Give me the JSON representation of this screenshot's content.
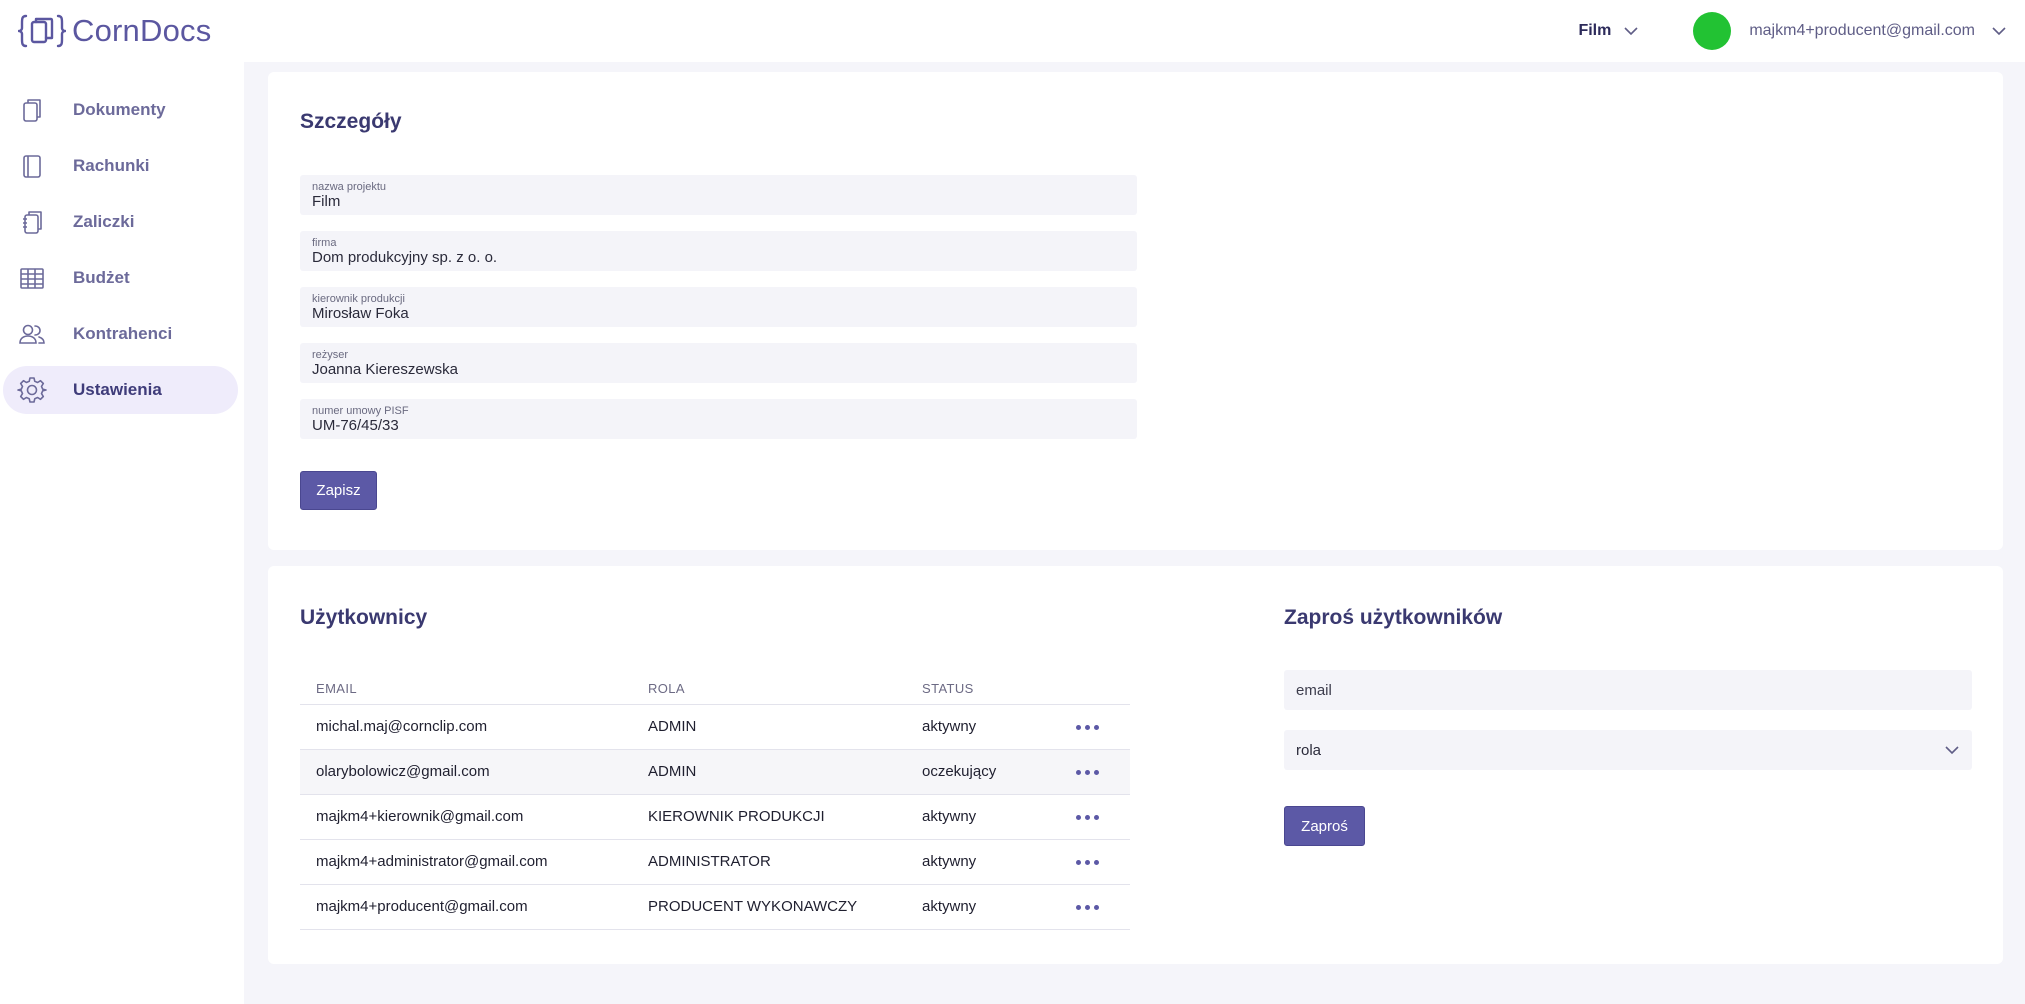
{
  "app": {
    "name": "CornDocs"
  },
  "header": {
    "project": "Film",
    "user_email": "majkm4+producent@gmail.com",
    "avatar_color": "#22c233"
  },
  "colors": {
    "accent": "#5c59a6",
    "title": "#3a3970",
    "active_nav_bg": "#efecfb"
  },
  "sidebar": {
    "items": [
      {
        "label": "Dokumenty",
        "icon": "documents-icon"
      },
      {
        "label": "Rachunki",
        "icon": "receipt-icon"
      },
      {
        "label": "Zaliczki",
        "icon": "notebook-icon"
      },
      {
        "label": "Budżet",
        "icon": "table-icon"
      },
      {
        "label": "Kontrahenci",
        "icon": "users-icon"
      },
      {
        "label": "Ustawienia",
        "icon": "gear-icon",
        "active": true
      }
    ]
  },
  "details": {
    "title": "Szczegóły",
    "fields": [
      {
        "label": "nazwa projektu",
        "value": "Film"
      },
      {
        "label": "firma",
        "value": "Dom produkcyjny sp. z o. o."
      },
      {
        "label": "kierownik produkcji",
        "value": "Mirosław Foka"
      },
      {
        "label": "reżyser",
        "value": "Joanna Kiereszewska"
      },
      {
        "label": "numer umowy PISF",
        "value": "UM-76/45/33"
      }
    ],
    "save_label": "Zapisz"
  },
  "users": {
    "title": "Użytkownicy",
    "columns": {
      "email": "EMAIL",
      "role": "ROLA",
      "status": "STATUS"
    },
    "rows": [
      {
        "email": "michal.maj@cornclip.com",
        "role": "ADMIN",
        "status": "aktywny"
      },
      {
        "email": "olarybolowicz@gmail.com",
        "role": "ADMIN",
        "status": "oczekujący"
      },
      {
        "email": "majkm4+kierownik@gmail.com",
        "role": "KIEROWNIK PRODUKCJI",
        "status": "aktywny"
      },
      {
        "email": "majkm4+administrator@gmail.com",
        "role": "ADMINISTRATOR",
        "status": "aktywny"
      },
      {
        "email": "majkm4+producent@gmail.com",
        "role": "PRODUCENT WYKONAWCZY",
        "status": "aktywny"
      }
    ]
  },
  "invite": {
    "title": "Zaproś użytkowników",
    "email_placeholder": "email",
    "role_placeholder": "rola",
    "submit_label": "Zaproś"
  }
}
